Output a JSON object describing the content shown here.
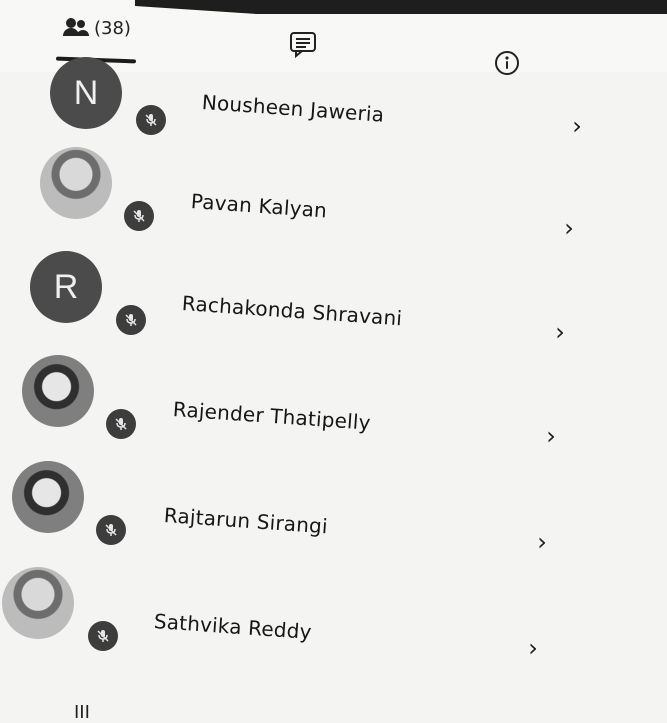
{
  "tabs": [
    {
      "label": "(38)",
      "icon": "people-icon"
    },
    {
      "label": "",
      "icon": "chat-icon"
    },
    {
      "label": "",
      "icon": "info-icon"
    }
  ],
  "participants": [
    {
      "name": "Nousheen Jaweria",
      "avatar_letter": "N",
      "avatar_type": "letter",
      "muted": true
    },
    {
      "name": "Pavan Kalyan",
      "avatar_letter": "",
      "avatar_type": "photo",
      "muted": true
    },
    {
      "name": "Rachakonda Shravani",
      "avatar_letter": "R",
      "avatar_type": "letter",
      "muted": true
    },
    {
      "name": "Rajender Thatipelly",
      "avatar_letter": "",
      "avatar_type": "photo",
      "muted": true
    },
    {
      "name": "Rajtarun Sirangi",
      "avatar_letter": "",
      "avatar_type": "photo",
      "muted": true
    },
    {
      "name": "Sathvika Reddy",
      "avatar_letter": "",
      "avatar_type": "photo",
      "muted": true
    }
  ],
  "bottom_nav": {
    "label": "III"
  }
}
